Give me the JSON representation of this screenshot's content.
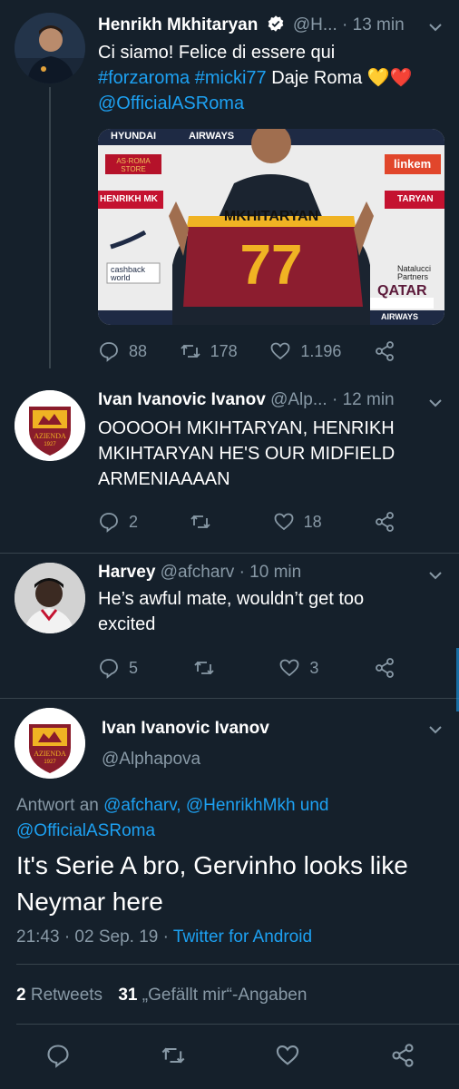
{
  "tweet1": {
    "name": "Henrikh Mkhitaryan",
    "handle": "@H...",
    "time": "· 13 min",
    "text_line1": "Ci siamo! Felice di essere qui",
    "hashtag1": "#forzaroma",
    "hashtag2": "#micki77",
    "text_line2_tail": "Daje Roma",
    "emoji": "💛❤️",
    "mention": "@OfficialASRoma",
    "media": {
      "sponsor_left": "HYUNDAI",
      "sponsor_airways": "AIRWAYS",
      "store_label": "AS·ROMA STORE",
      "linkem": "linkem",
      "name_left": "HENRIKH MK",
      "name_right": "TARYAN",
      "shirt_name": "MKHITARYAN",
      "shirt_number": "77",
      "cashback": "cashback world",
      "qatar": "QATAR",
      "qatar_sub": "AIRWAYS",
      "natalucci": "Natalucci Partners"
    },
    "replies": "88",
    "retweets": "178",
    "likes": "1.196"
  },
  "tweet2": {
    "name": "Ivan Ivanovic Ivanov",
    "handle": "@Alp...",
    "time": "· 12 min",
    "text": "OOOOOH MKIHTARYAN, HENRIKH MKIHTARYAN HE'S OUR MIDFIELD ARMENIAAAAN",
    "replies": "2",
    "likes": "18",
    "badge_text": "AZIENDA",
    "badge_year": "1927"
  },
  "tweet3": {
    "name": "Harvey",
    "handle": "@afcharv",
    "time": "· 10 min",
    "text": "He’s awful mate, wouldn’t get too excited",
    "replies": "5",
    "likes": "3"
  },
  "detail": {
    "name": "Ivan Ivanovic Ivanov",
    "handle": "@Alphapova",
    "reply_prefix": "Antwort an",
    "reply_to1": "@afcharv,",
    "reply_to2": "@HenrikhMkh",
    "reply_und": "und",
    "reply_to3": "@OfficialASRoma",
    "text": "It's Serie A bro, Gervinho looks like Neymar here",
    "timestamp": "21:43 · 02 Sep. 19 ·",
    "client": "Twitter for Android",
    "retweet_count": "2",
    "retweet_label": "Retweets",
    "like_count": "31",
    "like_label": "„Gefällt mir“-Angaben"
  },
  "colors": {
    "background": "#15202b",
    "accent": "#1da1f2",
    "muted": "#8899a6",
    "divider": "#38444d"
  },
  "icons": [
    "verified-badge-icon",
    "chevron-down-icon",
    "reply-icon",
    "retweet-icon",
    "like-icon",
    "share-icon"
  ]
}
